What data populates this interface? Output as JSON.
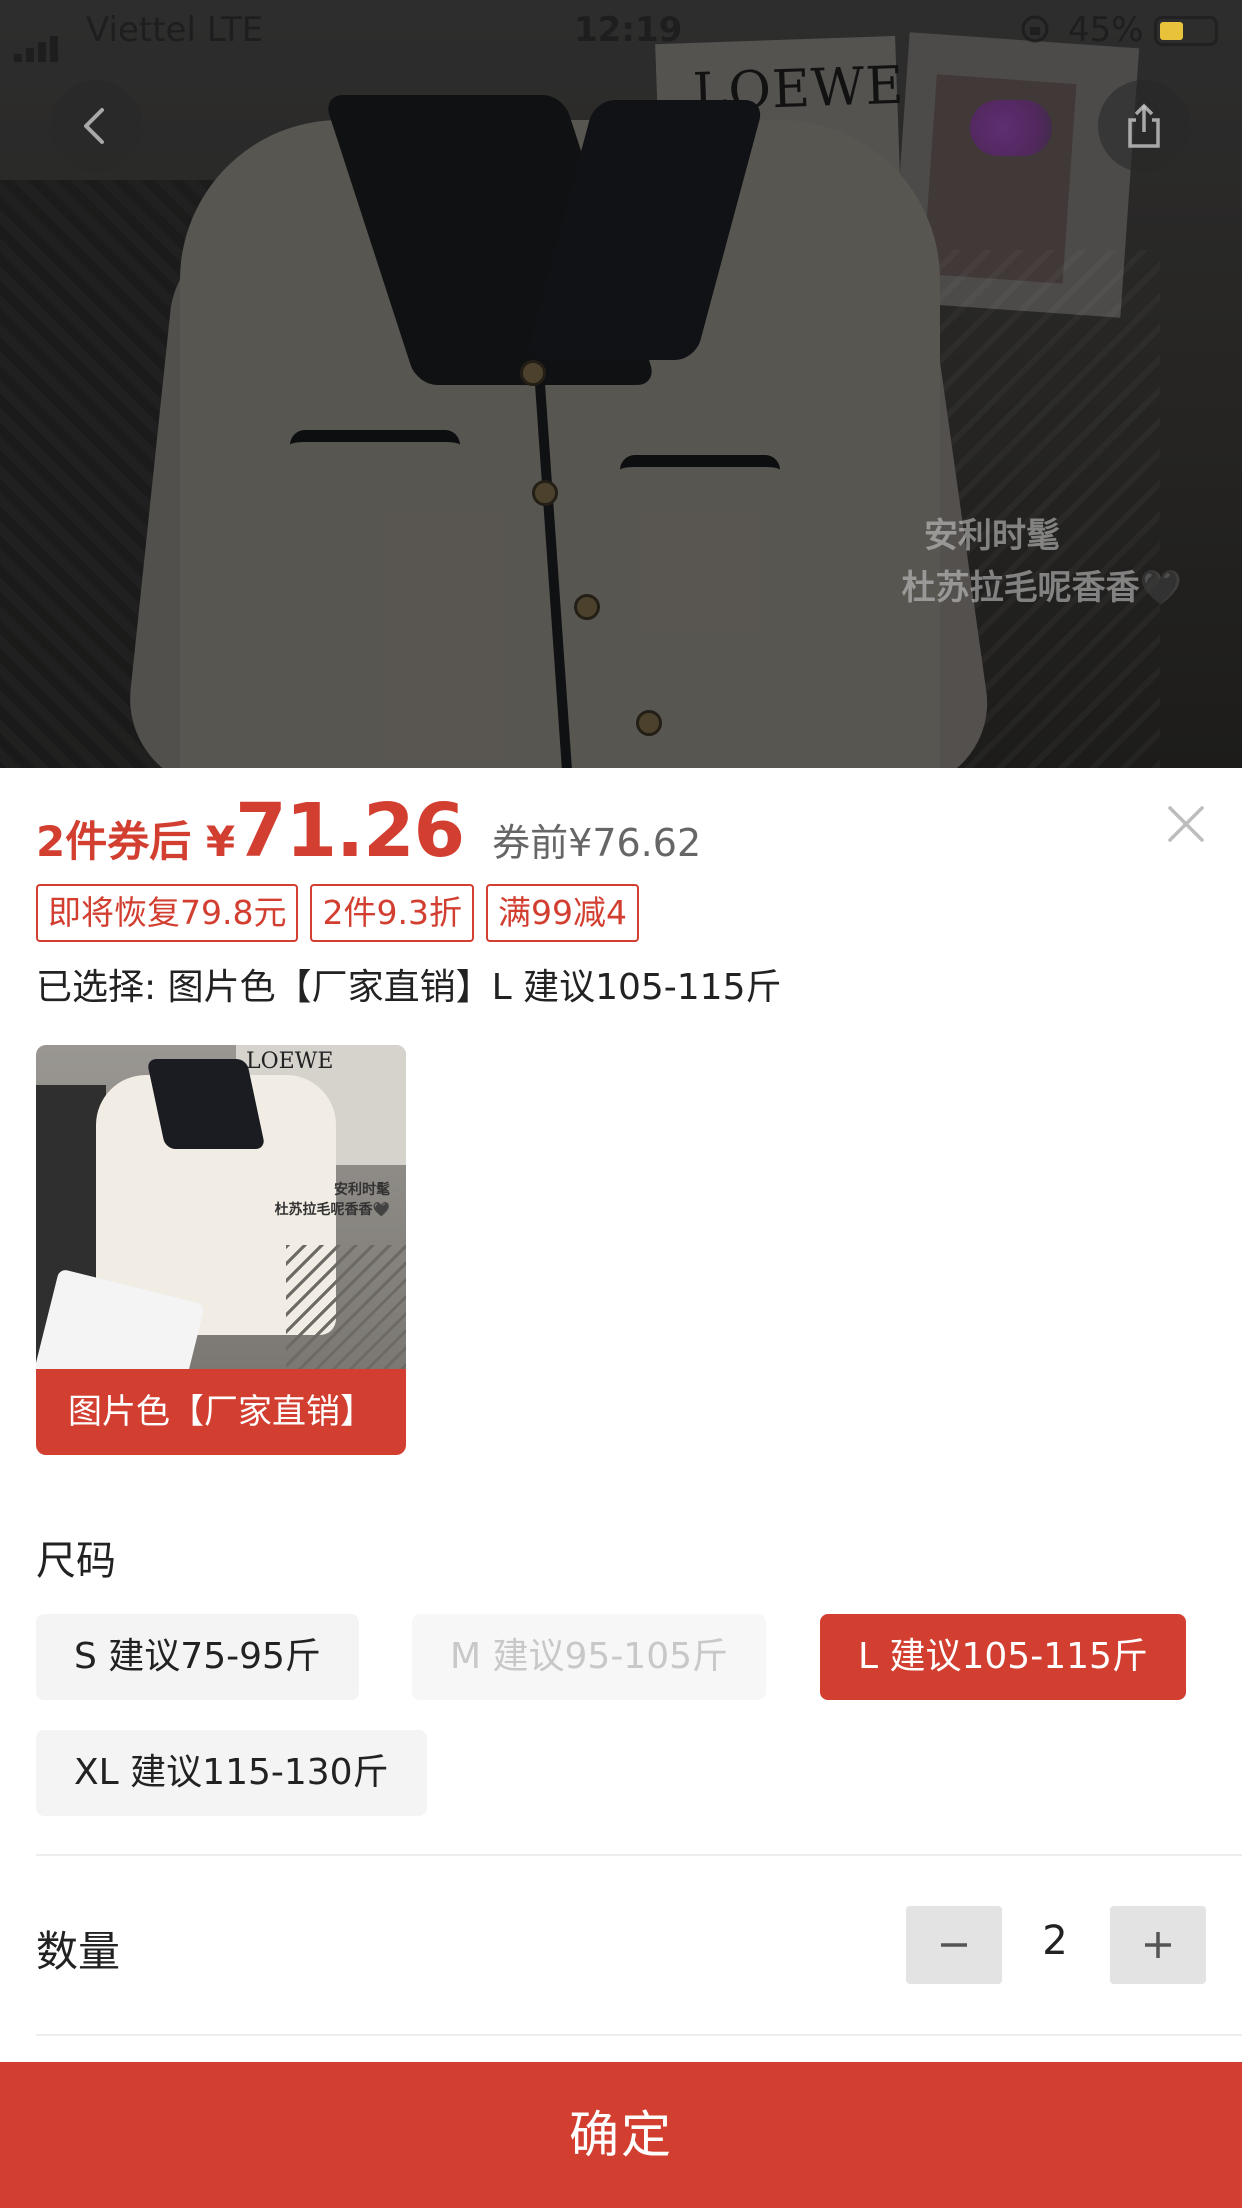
{
  "status_bar": {
    "carrier": "Viettel  LTE",
    "time": "12:19",
    "battery_percent": "45%",
    "battery_level": 0.45,
    "battery_color": "#e8c23a"
  },
  "hero": {
    "watermark_line1": "安利时髦",
    "watermark_line2": "杜苏拉毛呢香香🖤"
  },
  "nav": {
    "back_icon": "chevron-left-icon",
    "share_icon": "share-icon"
  },
  "price": {
    "prefix": "2件券后 ¥",
    "value": "71.26",
    "before_coupon": "券前¥76.62"
  },
  "tags": [
    "即将恢复79.8元",
    "2件9.3折",
    "满99减4"
  ],
  "selected_text": "已选择: 图片色【厂家直销】L 建议105-115斤",
  "variant": {
    "label": "图片色【厂家直销】",
    "thumb_watermark_line1": "安利时髦",
    "thumb_watermark_line2": "杜苏拉毛呢香香🖤"
  },
  "size": {
    "title": "尺码",
    "options": [
      {
        "label": "S 建议75-95斤",
        "state": "normal"
      },
      {
        "label": "M 建议95-105斤",
        "state": "disabled"
      },
      {
        "label": "L 建议105-115斤",
        "state": "selected"
      },
      {
        "label": "XL 建议115-130斤",
        "state": "normal"
      }
    ]
  },
  "quantity": {
    "title": "数量",
    "value": "2"
  },
  "confirm_label": "确定",
  "colors": {
    "accent": "#d23f31",
    "option_bg": "#f4f4f4",
    "stepper_bg": "#e3e3e3"
  }
}
